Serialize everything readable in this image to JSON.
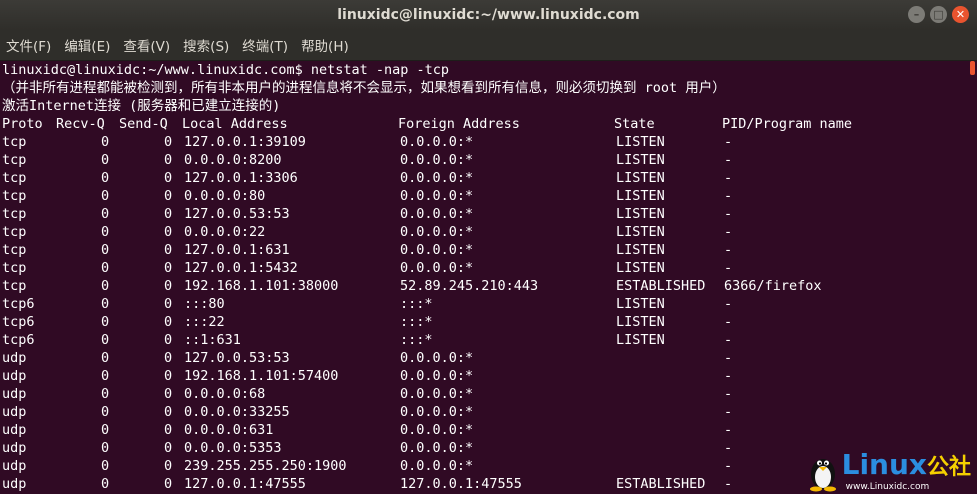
{
  "window": {
    "title": "linuxidc@linuxidc:~/www.linuxidc.com",
    "buttons": [
      "–",
      "□",
      "✕"
    ]
  },
  "menu": [
    "文件(F)",
    "编辑(E)",
    "查看(V)",
    "搜索(S)",
    "终端(T)",
    "帮助(H)"
  ],
  "terminal": {
    "prompt": "linuxidc@linuxidc:~/www.linuxidc.com$ netstat -nap -tcp",
    "warning": "（并非所有进程都能被检测到，所有非本用户的进程信息将不会显示，如果想看到所有信息，则必须切换到 root 用户）",
    "section": "激活Internet连接 (服务器和已建立连接的)",
    "header": [
      "Proto",
      "Recv-Q",
      "Send-Q",
      "Local Address",
      "Foreign Address",
      "State",
      "PID/Program name"
    ],
    "rows": [
      [
        "tcp",
        "0",
        "0",
        "127.0.0.1:39109",
        "0.0.0.0:*",
        "LISTEN",
        "-"
      ],
      [
        "tcp",
        "0",
        "0",
        "0.0.0.0:8200",
        "0.0.0.0:*",
        "LISTEN",
        "-"
      ],
      [
        "tcp",
        "0",
        "0",
        "127.0.0.1:3306",
        "0.0.0.0:*",
        "LISTEN",
        "-"
      ],
      [
        "tcp",
        "0",
        "0",
        "0.0.0.0:80",
        "0.0.0.0:*",
        "LISTEN",
        "-"
      ],
      [
        "tcp",
        "0",
        "0",
        "127.0.0.53:53",
        "0.0.0.0:*",
        "LISTEN",
        "-"
      ],
      [
        "tcp",
        "0",
        "0",
        "0.0.0.0:22",
        "0.0.0.0:*",
        "LISTEN",
        "-"
      ],
      [
        "tcp",
        "0",
        "0",
        "127.0.0.1:631",
        "0.0.0.0:*",
        "LISTEN",
        "-"
      ],
      [
        "tcp",
        "0",
        "0",
        "127.0.0.1:5432",
        "0.0.0.0:*",
        "LISTEN",
        "-"
      ],
      [
        "tcp",
        "0",
        "0",
        "192.168.1.101:38000",
        "52.89.245.210:443",
        "ESTABLISHED",
        "6366/firefox"
      ],
      [
        "tcp6",
        "0",
        "0",
        ":::80",
        ":::*",
        "LISTEN",
        "-"
      ],
      [
        "tcp6",
        "0",
        "0",
        ":::22",
        ":::*",
        "LISTEN",
        "-"
      ],
      [
        "tcp6",
        "0",
        "0",
        "::1:631",
        ":::*",
        "LISTEN",
        "-"
      ],
      [
        "udp",
        "0",
        "0",
        "127.0.0.53:53",
        "0.0.0.0:*",
        "",
        "-"
      ],
      [
        "udp",
        "0",
        "0",
        "192.168.1.101:57400",
        "0.0.0.0:*",
        "",
        "-"
      ],
      [
        "udp",
        "0",
        "0",
        "0.0.0.0:68",
        "0.0.0.0:*",
        "",
        "-"
      ],
      [
        "udp",
        "0",
        "0",
        "0.0.0.0:33255",
        "0.0.0.0:*",
        "",
        "-"
      ],
      [
        "udp",
        "0",
        "0",
        "0.0.0.0:631",
        "0.0.0.0:*",
        "",
        "-"
      ],
      [
        "udp",
        "0",
        "0",
        "0.0.0.0:5353",
        "0.0.0.0:*",
        "",
        "-"
      ],
      [
        "udp",
        "0",
        "0",
        "239.255.255.250:1900",
        "0.0.0.0:*",
        "",
        "-"
      ],
      [
        "udp",
        "0",
        "0",
        "127.0.0.1:47555",
        "127.0.0.1:47555",
        "ESTABLISHED",
        "-"
      ]
    ]
  },
  "logo": {
    "main": "Linux",
    "cn": "公社",
    "url": "www.Linuxidc.com"
  },
  "colors": {
    "terminal_bg": "#300a24",
    "text": "#ffffff",
    "close_button": "#e9542f",
    "logo_blue": "#2b8ee0"
  }
}
